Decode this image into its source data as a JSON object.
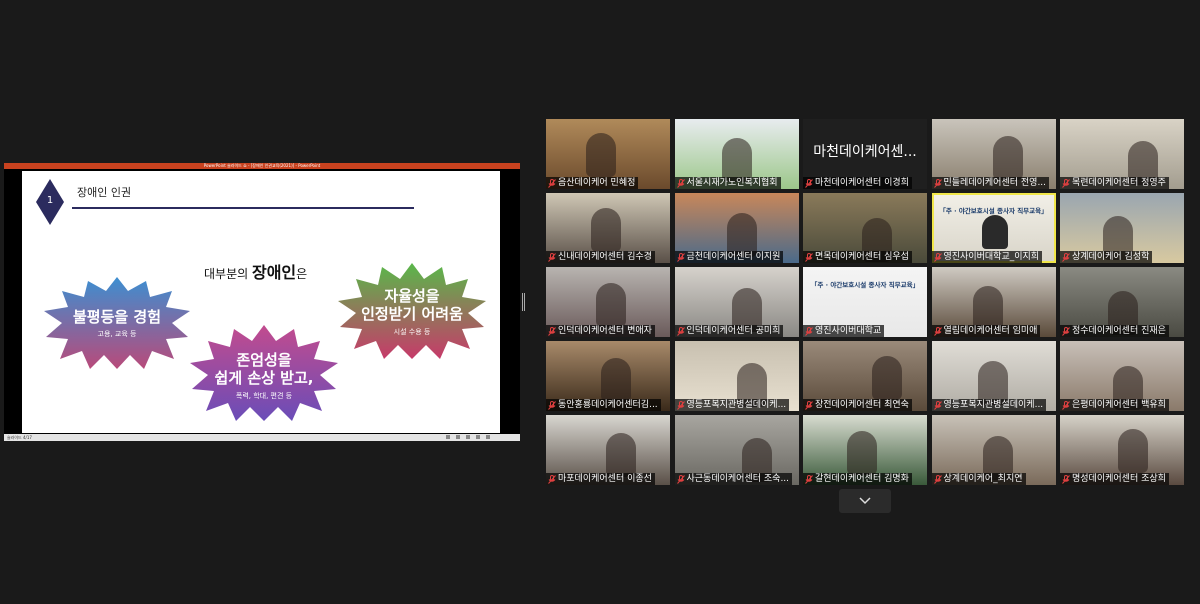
{
  "shared_screen": {
    "window_title": "PowerPoint 슬라이드 쇼 - [장애인 인권교육(2021)] - PowerPoint",
    "status_text": "슬라이드 4/17",
    "slide": {
      "number": "1",
      "title": "장애인 인권",
      "headline_prefix": "대부분의 ",
      "headline_bold": "장애인",
      "headline_suffix": "은",
      "bursts": [
        {
          "main": "불평등을 경험",
          "sub": "고용, 교육 등",
          "color_top": "#3d8fd1",
          "color_bottom": "#b94a7a"
        },
        {
          "main_line1": "존엄성을",
          "main_line2": "쉽게 손상 받고,",
          "sub": "폭력, 학대, 편견 등",
          "color_top": "#c24b8e",
          "color_bottom": "#6a4db8"
        },
        {
          "main_line1": "자율성을",
          "main_line2": "인정받기 어려움",
          "sub": "시설 수용 등",
          "color_top": "#59b84a",
          "color_bottom": "#c73a6a"
        }
      ]
    }
  },
  "participants": [
    {
      "name": "음산데이케어 민혜정",
      "card": ""
    },
    {
      "name": "서울시재가노인복지협회",
      "card": ""
    },
    {
      "name": "마천데이케어센터 이경희",
      "card": "마천데이케어센..."
    },
    {
      "name": "민들레데이케어센터 전영...",
      "card": ""
    },
    {
      "name": "목련데이케어센터 정영주",
      "card": ""
    },
    {
      "name": "신내데이케어센터 김수경",
      "card": ""
    },
    {
      "name": "금천데이케어센터 이지원",
      "card": ""
    },
    {
      "name": "면목데이케어센터 심우섭",
      "card": ""
    },
    {
      "name": "영진사이버대학교_이지희",
      "card": ""
    },
    {
      "name": "상계데이케어 김성학",
      "card": ""
    },
    {
      "name": "인덕데이케어센터 변애자",
      "card": ""
    },
    {
      "name": "인덕데이케어센터 공미희",
      "card": ""
    },
    {
      "name": "영진사이버대학교",
      "card": ""
    },
    {
      "name": "열림데이케어센터 임미애",
      "card": ""
    },
    {
      "name": "정수데이케어센터 진재은",
      "card": ""
    },
    {
      "name": "동안홍룡데이케어센터김...",
      "card": ""
    },
    {
      "name": "영등포복지관병설데이케...",
      "card": ""
    },
    {
      "name": "장전데이케어센터 최연숙",
      "card": ""
    },
    {
      "name": "영등포복지관병설데이케...",
      "card": ""
    },
    {
      "name": "은평데이케어센터 백유희",
      "card": ""
    },
    {
      "name": "마포데이케어센터 이종선",
      "card": ""
    },
    {
      "name": "사근동데이케어센터 조숙...",
      "card": ""
    },
    {
      "name": "갈현데이케어센터 김명화",
      "card": ""
    },
    {
      "name": "상계데이케어_최지연",
      "card": ""
    },
    {
      "name": "명성데이케어센터 조상희",
      "card": ""
    }
  ],
  "screen_banner": "「주 · 야간보호시설 종사자 직무교육」",
  "icons": {
    "mic": "mic-muted-icon",
    "scroll": "chevron-down-icon"
  },
  "colors": {
    "background": "#1a1a1a",
    "active_speaker": "#f0e64a",
    "mic_muted": "#e04040"
  }
}
